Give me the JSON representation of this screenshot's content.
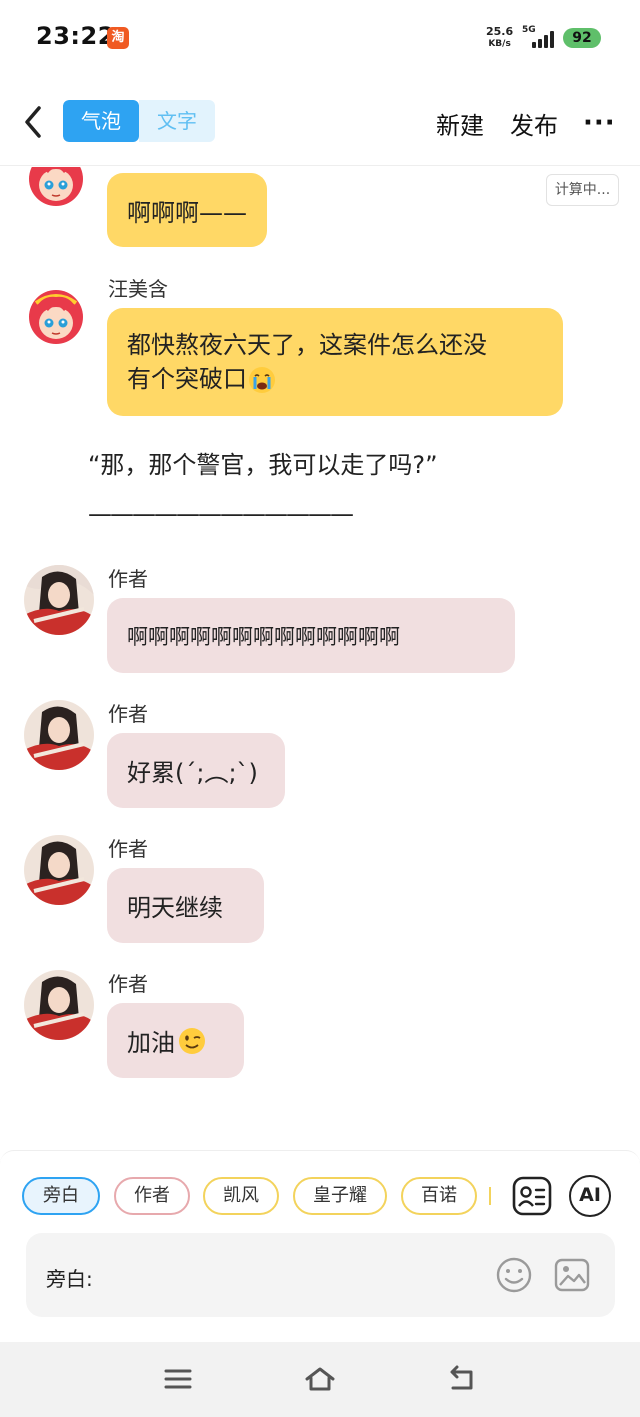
{
  "status": {
    "time": "23:22",
    "app_badge": "淘",
    "net_speed_value": "25.6",
    "net_speed_unit": "KB/s",
    "network": "5G",
    "battery": "92"
  },
  "header": {
    "tabs": [
      {
        "label": "气泡",
        "active": true
      },
      {
        "label": "文字",
        "active": false
      }
    ],
    "new_label": "新建",
    "publish_label": "发布",
    "more_label": "···"
  },
  "chat": {
    "calc_badge": "计算中...",
    "messages": [
      {
        "speaker": "",
        "text": "啊啊啊——",
        "style": "yellow"
      },
      {
        "speaker": "汪美含",
        "text_line1": "都快熬夜六天了，这案件怎么还没",
        "text_line2": "有个突破口",
        "emoji": "crying-face",
        "style": "yellow"
      },
      {
        "narration_line1": "“那，那个警官，我可以走了吗?”",
        "narration_line2": "————————————"
      },
      {
        "speaker": "作者",
        "text": "啊啊啊啊啊啊啊啊啊啊啊啊啊",
        "style": "pink"
      },
      {
        "speaker": "作者",
        "text": "好累(´;︵;`)",
        "style": "pink"
      },
      {
        "speaker": "作者",
        "text": "明天继续",
        "style": "pink"
      },
      {
        "speaker": "作者",
        "text": "加油",
        "emoji": "winking-face",
        "style": "pink"
      }
    ]
  },
  "bottom": {
    "chips": [
      "旁白",
      "作者",
      "凯风",
      "皇子耀",
      "百诺"
    ],
    "ai_label": "AI",
    "input_label": "旁白:"
  },
  "colors": {
    "accent": "#2ea3f2",
    "bubble_yellow": "#ffd866",
    "bubble_pink": "#f1dfe0",
    "battery": "#5fbf6a"
  }
}
